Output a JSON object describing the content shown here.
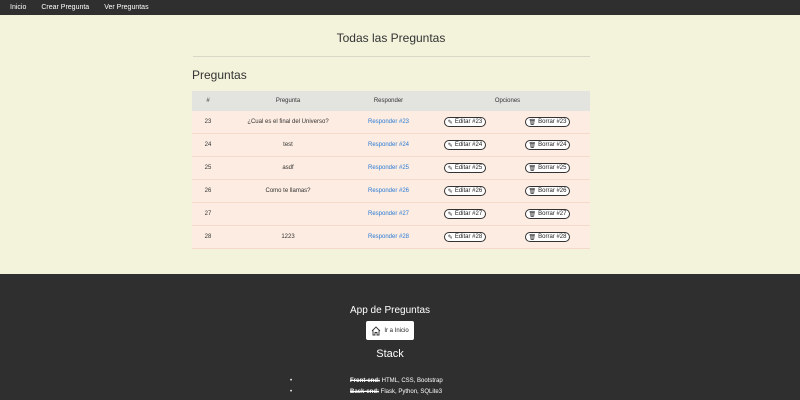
{
  "nav": {
    "items": [
      "Inicio",
      "Crear Pregunta",
      "Ver Preguntas"
    ]
  },
  "main": {
    "title": "Todas las Preguntas",
    "section_title": "Preguntas",
    "table": {
      "headers": [
        "#",
        "Pregunta",
        "Responder",
        "Opciones"
      ],
      "rows": [
        {
          "id": "23",
          "pregunta": "¿Cual es el final del Universo?",
          "responder": "Responder #23",
          "editar": "Editar #23",
          "borrar": "Borrar #23"
        },
        {
          "id": "24",
          "pregunta": "test",
          "responder": "Responder #24",
          "editar": "Editar #24",
          "borrar": "Borrar #24"
        },
        {
          "id": "25",
          "pregunta": "asdf",
          "responder": "Responder #25",
          "editar": "Editar #25",
          "borrar": "Borrar #25"
        },
        {
          "id": "26",
          "pregunta": "Como te llamas?",
          "responder": "Responder #26",
          "editar": "Editar #26",
          "borrar": "Borrar #26"
        },
        {
          "id": "27",
          "pregunta": "",
          "responder": "Responder #27",
          "editar": "Editar #27",
          "borrar": "Borrar #27"
        },
        {
          "id": "28",
          "pregunta": "1223",
          "responder": "Responder #28",
          "editar": "Editar #28",
          "borrar": "Borrar #28"
        }
      ]
    }
  },
  "footer": {
    "title": "App de Preguntas",
    "home_button": "Ir a Inicio",
    "stack_title": "Stack",
    "stack": [
      {
        "label": "Front-end:",
        "value": " HTML, CSS, Bootstrap"
      },
      {
        "label": "Back-end:",
        "value": " Flask, Python, SQLite3"
      }
    ]
  },
  "colors": {
    "page_bg": "#f3f3dc",
    "nav_bg": "#2f2f2f",
    "row_bg": "#fdece1",
    "header_bg": "#e3e3e0",
    "link": "#2a7bd6"
  },
  "icons": {
    "edit": "pencil-icon",
    "delete": "trash-icon",
    "home": "home-icon"
  }
}
